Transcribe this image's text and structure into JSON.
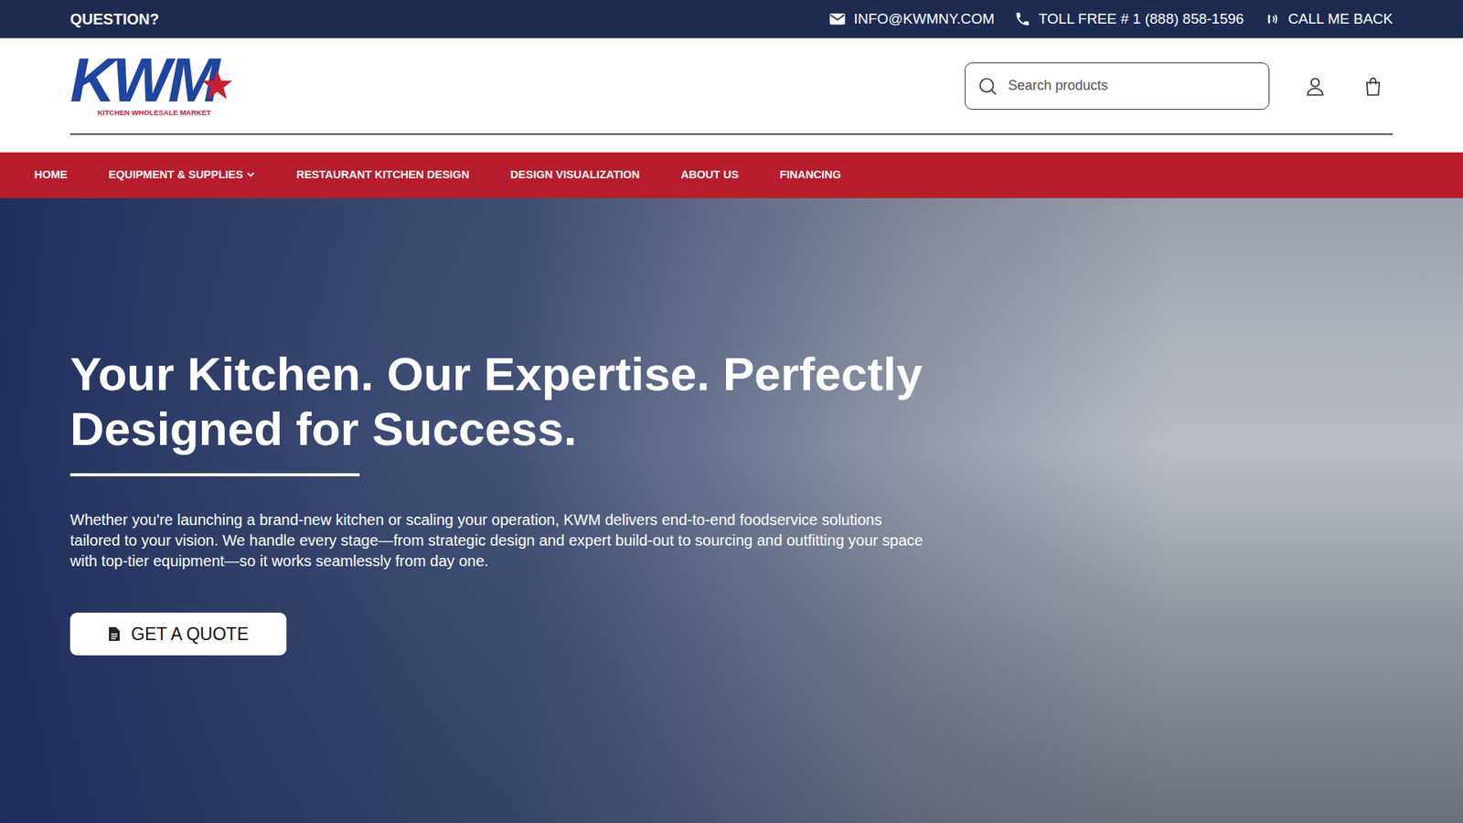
{
  "topbar": {
    "question": "QUESTION?",
    "contacts": [
      {
        "kind": "email",
        "label": "INFO@KWMNY.COM"
      },
      {
        "kind": "phone",
        "label": "TOLL FREE # 1 (888) 858-1596"
      },
      {
        "kind": "callback",
        "label": "CALL ME BACK"
      }
    ]
  },
  "logo": {
    "text": "KWM",
    "tagline": "KITCHEN WHOLESALE MARKET"
  },
  "search": {
    "placeholder": "Search products"
  },
  "nav": [
    {
      "label": "HOME",
      "has_menu": false,
      "selected": false
    },
    {
      "label": "EQUIPMENT & SUPPLIES",
      "has_menu": true,
      "selected": false
    },
    {
      "label": "RESTAURANT KITCHEN DESIGN",
      "has_menu": false,
      "selected": false
    },
    {
      "label": "DESIGN VISUALIZATION",
      "has_menu": false,
      "selected": false
    },
    {
      "label": "ABOUT US",
      "has_menu": false,
      "selected": false
    },
    {
      "label": "FINANCING",
      "has_menu": false,
      "selected": false
    }
  ],
  "hero": {
    "title_lines": [
      "Your Kitchen. Our Expertise. Perfectly",
      "Designed for Success."
    ],
    "text": "Whether you're launching a brand-new kitchen or scaling your operation, KWM delivers end-to-end foodservice solutions tailored to your vision. We handle every stage—from strategic design and expert build-out to sourcing and outfitting your space with top-tier equipment—so it works seamlessly from day one.",
    "button": "GET A QUOTE"
  }
}
